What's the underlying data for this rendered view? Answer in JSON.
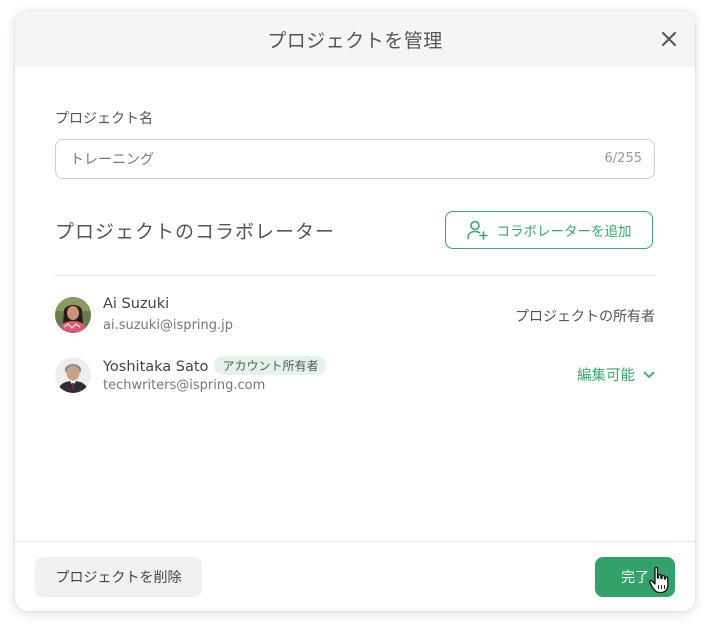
{
  "dialog": {
    "title": "プロジェクトを管理",
    "close_icon": "close-icon"
  },
  "project_name": {
    "label": "プロジェクト名",
    "value": "トレーニング",
    "char_count": "6/255"
  },
  "collaborators": {
    "title": "プロジェクトのコラボレーター",
    "add_button_label": "コラボレーターを追加",
    "add_icon": "add-user-icon",
    "users": [
      {
        "name": "Ai Suzuki",
        "email": "ai.suzuki@ispring.jp",
        "role": "プロジェクトの所有者"
      },
      {
        "name": "Yoshitaka Sato",
        "badge": "アカウント所有者",
        "email": "techwriters@ispring.com",
        "role": "編集可能"
      }
    ]
  },
  "footer": {
    "delete_label": "プロジェクトを削除",
    "done_label": "完了"
  },
  "colors": {
    "accent": "#3aa76d",
    "done_button": "#34a06a",
    "badge_bg": "#e3f3e9",
    "header_bg": "#f5f5f5"
  }
}
